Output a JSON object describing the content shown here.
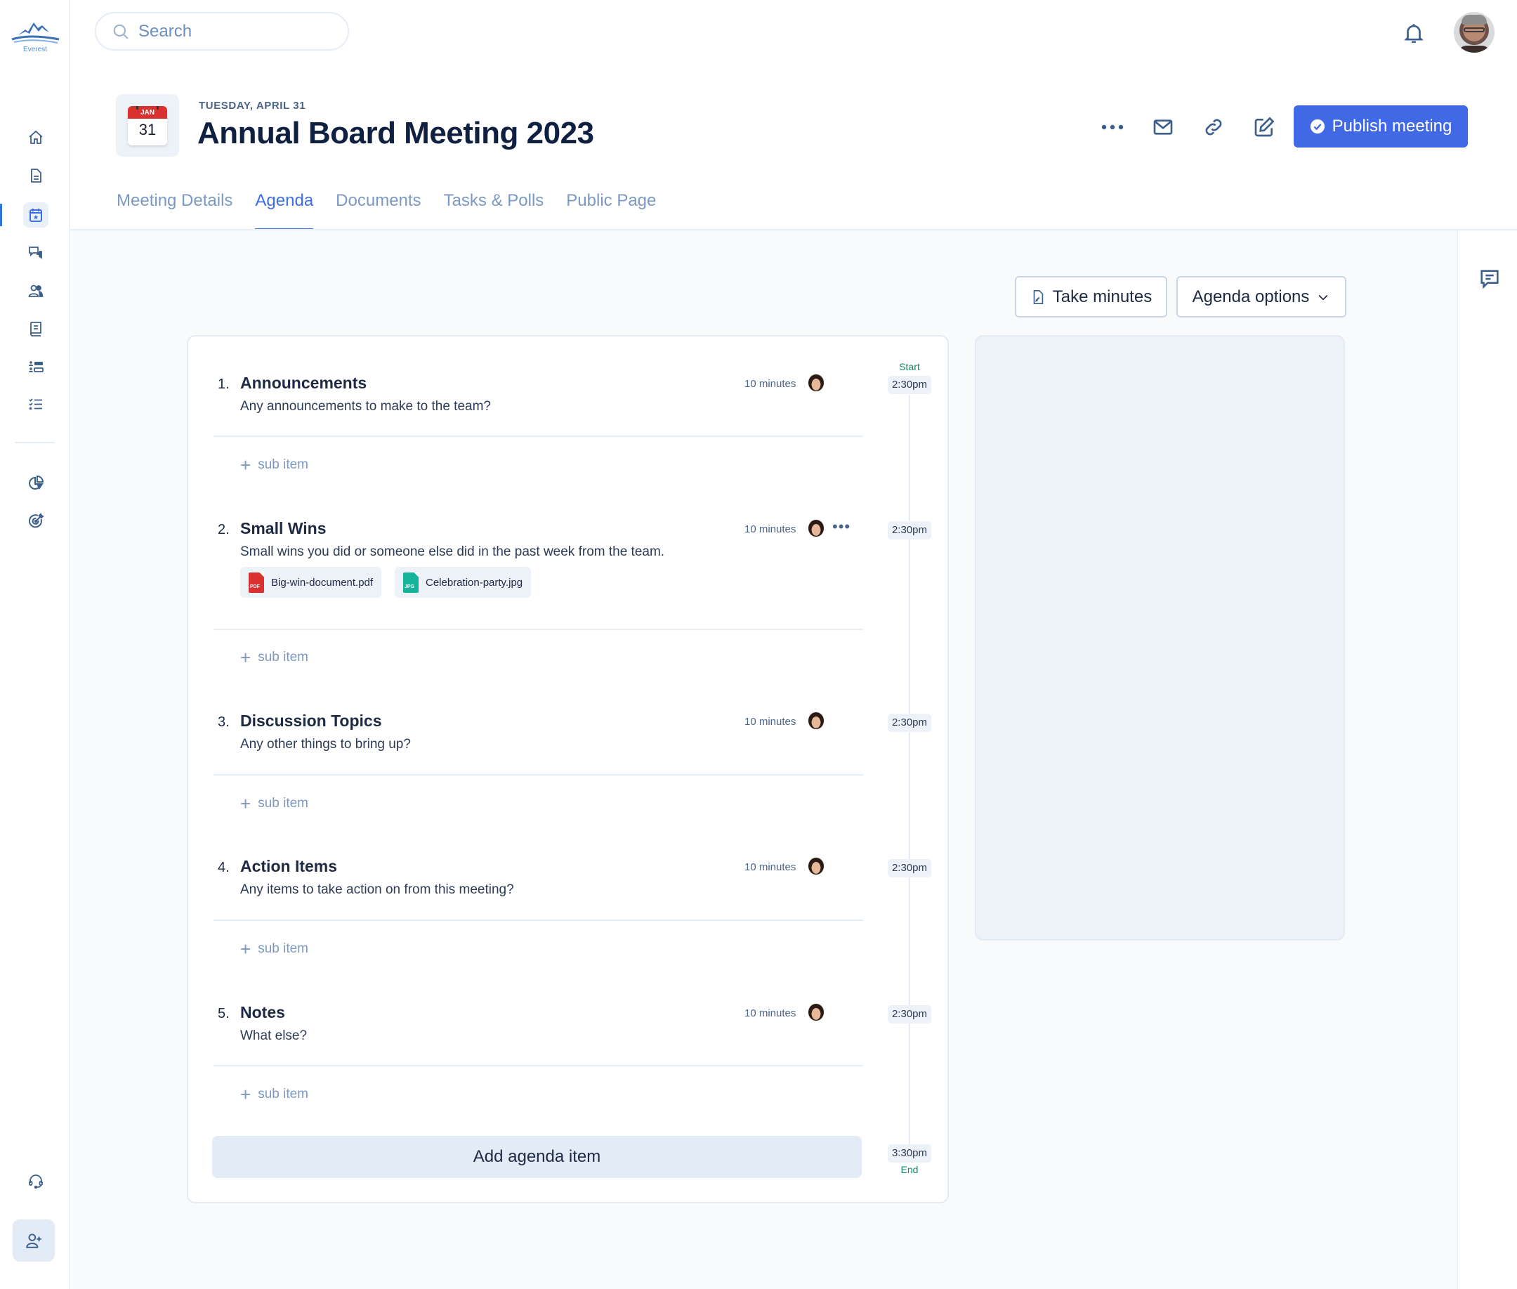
{
  "app": {
    "name": "Everest"
  },
  "search": {
    "placeholder": "Search",
    "value": ""
  },
  "sidebar": {
    "items": [
      {
        "id": "home",
        "icon": "home-icon",
        "active": false
      },
      {
        "id": "documents",
        "icon": "document-icon",
        "active": false
      },
      {
        "id": "meetings",
        "icon": "calendar-star-icon",
        "active": true
      },
      {
        "id": "discussions",
        "icon": "chat-icon",
        "active": false
      },
      {
        "id": "people",
        "icon": "users-icon",
        "active": false
      },
      {
        "id": "library",
        "icon": "book-icon",
        "active": false
      },
      {
        "id": "directory",
        "icon": "user-list-icon",
        "active": false
      },
      {
        "id": "tasks",
        "icon": "checklist-icon",
        "active": false
      },
      {
        "id": "reports",
        "icon": "pie-chart-icon",
        "active": false
      },
      {
        "id": "goals",
        "icon": "target-icon",
        "active": false
      }
    ],
    "bottom": [
      {
        "id": "support",
        "icon": "headset-icon"
      },
      {
        "id": "invite",
        "icon": "user-plus-icon"
      }
    ]
  },
  "meeting": {
    "calendar_month": "JAN",
    "calendar_day": "31",
    "date_label": "TUESDAY, APRIL 31",
    "title": "Annual Board Meeting 2023"
  },
  "header_actions": {
    "more": "more-icon",
    "email": "mail-icon",
    "link": "link-icon",
    "edit": "edit-icon",
    "publish_label": "Publish meeting"
  },
  "tabs": [
    {
      "label": "Meeting Details",
      "active": false
    },
    {
      "label": "Agenda",
      "active": true
    },
    {
      "label": "Documents",
      "active": false
    },
    {
      "label": "Tasks & Polls",
      "active": false
    },
    {
      "label": "Public Page",
      "active": false
    }
  ],
  "toolbar": {
    "take_minutes_label": "Take minutes",
    "agenda_options_label": "Agenda options"
  },
  "agenda": {
    "start_label": "Start",
    "end_label": "End",
    "end_time": "3:30pm",
    "sub_item_label": "sub item",
    "add_item_label": "Add agenda item",
    "items": [
      {
        "number": "1.",
        "title": "Announcements",
        "description": "Any announcements to make to the team?",
        "duration": "10 minutes",
        "time": "2:30pm",
        "attachments": []
      },
      {
        "number": "2.",
        "title": "Small Wins",
        "description": "Small wins you did or someone else did in the past week from the team.",
        "duration": "10 minutes",
        "time": "2:30pm",
        "attachments": [
          {
            "name": "Big-win-document.pdf",
            "type": "PDF",
            "color": "#d9312f"
          },
          {
            "name": "Celebration-party.jpg",
            "type": "JPG",
            "color": "#14b39a"
          }
        ]
      },
      {
        "number": "3.",
        "title": "Discussion Topics",
        "description": "Any other things to bring up?",
        "duration": "10 minutes",
        "time": "2:30pm",
        "attachments": []
      },
      {
        "number": "4.",
        "title": "Action Items",
        "description": "Any items to take action on from this meeting?",
        "duration": "10 minutes",
        "time": "2:30pm",
        "attachments": []
      },
      {
        "number": "5.",
        "title": "Notes",
        "description": "What else?",
        "duration": "10 minutes",
        "time": "2:30pm",
        "attachments": []
      }
    ]
  },
  "colors": {
    "primary": "#4169e6",
    "active_tab": "#3e6fe6",
    "start_end_label": "#128c5e",
    "pdf": "#d9312f",
    "jpg": "#14b39a"
  }
}
